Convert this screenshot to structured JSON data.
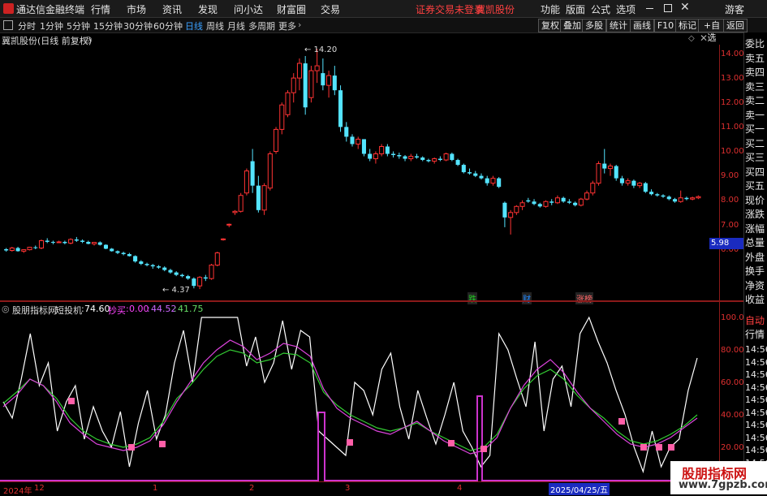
{
  "menubar": {
    "app_name": "通达信金融终端",
    "menus": [
      "行情",
      "市场",
      "资讯",
      "发现",
      "问小达",
      "财富圈",
      "交易"
    ],
    "notice": "证券交易未登录",
    "stock_name": "冀凯股份",
    "right_menus": [
      "功能",
      "版面",
      "公式",
      "选项"
    ],
    "guest": "游客",
    "window_controls": [
      "minimize-icon",
      "maximize-icon",
      "close-icon"
    ]
  },
  "periods": [
    "分时",
    "1分钟",
    "5分钟",
    "15分钟",
    "30分钟",
    "60分钟",
    "日线",
    "周线",
    "月线",
    "多周期",
    "更多"
  ],
  "active_period": "日线",
  "toolbar_buttons": [
    "复权",
    "叠加",
    "多股",
    "统计",
    "画线",
    "F10",
    "标记",
    "+自选",
    "返回"
  ],
  "main_chart": {
    "title": "冀凯股份(日线 前复权)",
    "high_label": "14.20",
    "low_label": "4.37",
    "current_price": "5.98",
    "y_ticks": [
      "14.00",
      "13.00",
      "12.00",
      "11.00",
      "10.00",
      "9.00",
      "8.00",
      "7.00",
      "6.00"
    ],
    "events": [
      {
        "label": "跌",
        "color": "#22cc22"
      },
      {
        "label": "财",
        "color": "#2288ff"
      },
      {
        "label": "涨榜",
        "color": "#ff6666"
      }
    ]
  },
  "indicator": {
    "title": "股朋指标网",
    "name": "短投机",
    "value": "74.60",
    "buy_label": "抄买",
    "buy_value": "0.00",
    "v2": "44.52",
    "v3": "41.75",
    "y_ticks": [
      "100.0",
      "80.00",
      "60.00",
      "40.00",
      "20.00"
    ]
  },
  "side_panel": {
    "labels": [
      "委比",
      "卖五",
      "卖四",
      "卖三",
      "卖二",
      "卖一",
      "买一",
      "买二",
      "买三",
      "买四",
      "买五",
      "现价",
      "涨跌",
      "涨幅",
      "总量",
      "外盘",
      "换手",
      "净资",
      "收益"
    ],
    "tabs": [
      "自动",
      "行情"
    ],
    "times": [
      "14:56",
      "14:56",
      "14:56",
      "14:56",
      "14:56",
      "14:56",
      "14:56",
      "14:56",
      "14:56",
      "14:56"
    ]
  },
  "time_axis": {
    "labels": [
      "2024年",
      "12",
      "1",
      "2",
      "3",
      "4",
      "2025/04/25/五"
    ]
  },
  "watermark": {
    "title": "股朋指标网",
    "url": "www.7gpzb.com"
  },
  "chart_data": {
    "type": "candlestick",
    "title": "冀凯股份(日线 前复权)",
    "ylim": [
      5.5,
      14.6
    ],
    "ohlc": [
      [
        6.0,
        6.05,
        5.9,
        5.95
      ],
      [
        5.95,
        6.1,
        5.9,
        6.05
      ],
      [
        6.05,
        6.1,
        5.9,
        5.92
      ],
      [
        5.92,
        6.0,
        5.85,
        5.98
      ],
      [
        5.98,
        6.1,
        5.95,
        6.08
      ],
      [
        6.08,
        6.15,
        6.0,
        6.05
      ],
      [
        6.05,
        6.4,
        6.0,
        6.35
      ],
      [
        6.35,
        6.45,
        6.25,
        6.3
      ],
      [
        6.3,
        6.35,
        6.2,
        6.28
      ],
      [
        6.28,
        6.35,
        6.25,
        6.3
      ],
      [
        6.3,
        6.35,
        6.2,
        6.25
      ],
      [
        6.25,
        6.45,
        6.2,
        6.4
      ],
      [
        6.4,
        6.5,
        6.3,
        6.35
      ],
      [
        6.35,
        6.4,
        6.25,
        6.3
      ],
      [
        6.3,
        6.35,
        6.2,
        6.22
      ],
      [
        6.22,
        6.3,
        6.15,
        6.28
      ],
      [
        6.28,
        6.32,
        6.15,
        6.18
      ],
      [
        6.18,
        6.2,
        6.0,
        6.02
      ],
      [
        6.02,
        6.05,
        5.9,
        5.92
      ],
      [
        5.92,
        5.95,
        5.8,
        5.85
      ],
      [
        5.85,
        5.9,
        5.75,
        5.8
      ],
      [
        5.8,
        5.85,
        5.7,
        5.72
      ],
      [
        5.72,
        5.75,
        5.45,
        5.5
      ],
      [
        5.5,
        5.55,
        5.35,
        5.4
      ],
      [
        5.4,
        5.45,
        5.3,
        5.35
      ],
      [
        5.35,
        5.4,
        5.2,
        5.3
      ],
      [
        5.3,
        5.35,
        5.2,
        5.25
      ],
      [
        5.25,
        5.3,
        5.1,
        5.15
      ],
      [
        5.15,
        5.2,
        5.0,
        5.05
      ],
      [
        5.05,
        5.1,
        4.9,
        4.95
      ],
      [
        4.95,
        5.0,
        4.85,
        4.9
      ],
      [
        4.9,
        4.95,
        4.75,
        4.8
      ],
      [
        4.8,
        4.85,
        4.4,
        4.5
      ],
      [
        4.5,
        4.9,
        4.37,
        4.85
      ],
      [
        4.85,
        4.95,
        4.7,
        4.8
      ],
      [
        4.8,
        5.4,
        4.75,
        5.35
      ],
      [
        5.35,
        5.9,
        5.3,
        5.85
      ],
      [
        6.4,
        6.45,
        6.35,
        6.42
      ],
      [
        7.0,
        7.05,
        6.9,
        7.02
      ],
      [
        7.5,
        7.6,
        7.4,
        7.55
      ],
      [
        7.55,
        8.3,
        7.5,
        8.2
      ],
      [
        8.3,
        9.3,
        8.2,
        9.2
      ],
      [
        9.6,
        10.1,
        8.3,
        8.6
      ],
      [
        8.6,
        9.0,
        7.5,
        7.6
      ],
      [
        7.6,
        8.7,
        7.4,
        8.6
      ],
      [
        8.5,
        10.0,
        8.4,
        9.9
      ],
      [
        10.0,
        11.0,
        9.9,
        10.9
      ],
      [
        10.9,
        12.0,
        10.7,
        11.9
      ],
      [
        11.5,
        12.5,
        11.4,
        12.4
      ],
      [
        12.4,
        13.2,
        12.0,
        13.0
      ],
      [
        13.0,
        13.8,
        12.5,
        13.6
      ],
      [
        13.6,
        13.9,
        11.5,
        11.8
      ],
      [
        12.2,
        13.5,
        12.0,
        13.3
      ],
      [
        13.3,
        14.2,
        12.8,
        13.5
      ],
      [
        13.2,
        13.8,
        12.5,
        12.7
      ],
      [
        12.7,
        13.3,
        12.2,
        13.1
      ],
      [
        13.1,
        13.5,
        12.3,
        12.5
      ],
      [
        12.5,
        12.7,
        10.8,
        11.0
      ],
      [
        11.0,
        11.2,
        10.4,
        10.6
      ],
      [
        10.6,
        10.7,
        10.2,
        10.3
      ],
      [
        10.3,
        10.6,
        10.1,
        10.5
      ],
      [
        10.5,
        10.5,
        9.8,
        9.9
      ],
      [
        9.9,
        10.1,
        9.6,
        9.7
      ],
      [
        9.7,
        10.0,
        9.5,
        9.9
      ],
      [
        9.9,
        10.3,
        9.8,
        10.2
      ],
      [
        10.2,
        10.3,
        9.8,
        9.9
      ],
      [
        9.9,
        10.0,
        9.75,
        9.85
      ],
      [
        9.85,
        9.95,
        9.7,
        9.8
      ],
      [
        9.8,
        9.85,
        9.6,
        9.7
      ],
      [
        9.7,
        9.9,
        9.6,
        9.8
      ],
      [
        9.8,
        9.9,
        9.7,
        9.75
      ],
      [
        9.75,
        9.8,
        9.6,
        9.65
      ],
      [
        9.65,
        9.7,
        9.55,
        9.6
      ],
      [
        9.6,
        9.75,
        9.5,
        9.7
      ],
      [
        9.7,
        9.8,
        9.6,
        9.65
      ],
      [
        9.65,
        9.95,
        9.6,
        9.9
      ],
      [
        9.9,
        9.95,
        9.6,
        9.65
      ],
      [
        9.65,
        9.7,
        9.4,
        9.45
      ],
      [
        9.45,
        9.5,
        9.1,
        9.15
      ],
      [
        9.15,
        9.3,
        9.05,
        9.1
      ],
      [
        9.1,
        9.2,
        8.95,
        9.0
      ],
      [
        9.0,
        9.1,
        8.85,
        8.9
      ],
      [
        8.9,
        9.0,
        8.6,
        8.7
      ],
      [
        8.7,
        9.0,
        8.6,
        8.9
      ],
      [
        8.9,
        8.95,
        8.5,
        8.55
      ],
      [
        7.9,
        7.95,
        6.9,
        7.3
      ],
      [
        7.3,
        7.6,
        6.6,
        7.5
      ],
      [
        7.5,
        7.8,
        7.4,
        7.75
      ],
      [
        7.75,
        8.0,
        7.6,
        7.9
      ],
      [
        8.0,
        8.1,
        7.9,
        7.95
      ],
      [
        7.95,
        8.05,
        7.8,
        7.85
      ],
      [
        7.85,
        7.9,
        7.7,
        7.75
      ],
      [
        7.75,
        8.0,
        7.7,
        7.95
      ],
      [
        7.95,
        8.05,
        7.8,
        7.9
      ],
      [
        7.9,
        8.2,
        7.85,
        8.1
      ],
      [
        8.1,
        8.15,
        7.9,
        7.95
      ],
      [
        7.95,
        8.05,
        7.85,
        7.9
      ],
      [
        7.9,
        7.95,
        7.75,
        7.8
      ],
      [
        7.8,
        8.1,
        7.75,
        8.05
      ],
      [
        8.05,
        8.4,
        8.0,
        8.3
      ],
      [
        8.3,
        8.8,
        8.2,
        8.7
      ],
      [
        8.7,
        9.6,
        8.6,
        9.5
      ],
      [
        9.5,
        10.1,
        9.1,
        9.3
      ],
      [
        9.3,
        9.5,
        9.0,
        9.4
      ],
      [
        9.4,
        9.45,
        8.8,
        8.9
      ],
      [
        8.9,
        9.0,
        8.6,
        8.7
      ],
      [
        8.7,
        8.9,
        8.6,
        8.8
      ],
      [
        8.8,
        8.85,
        8.5,
        8.6
      ],
      [
        8.6,
        8.75,
        8.5,
        8.7
      ],
      [
        8.7,
        8.75,
        8.3,
        8.35
      ],
      [
        8.35,
        8.45,
        8.2,
        8.25
      ],
      [
        8.25,
        8.3,
        8.15,
        8.2
      ],
      [
        8.2,
        8.25,
        8.1,
        8.15
      ],
      [
        8.15,
        8.2,
        8.0,
        8.05
      ],
      [
        8.05,
        8.1,
        7.9,
        7.95
      ],
      [
        7.95,
        8.4,
        7.9,
        8.1
      ],
      [
        8.1,
        8.15,
        8.0,
        8.05
      ],
      [
        8.05,
        8.15,
        8.0,
        8.1
      ],
      [
        8.1,
        8.2,
        8.05,
        8.15
      ]
    ],
    "indicator_white": [
      48,
      38,
      62,
      90,
      58,
      72,
      30,
      48,
      58,
      25,
      45,
      30,
      20,
      42,
      8,
      35,
      55,
      25,
      40,
      72,
      92,
      60,
      100,
      100,
      100,
      100,
      100,
      70,
      88,
      60,
      72,
      98,
      68,
      92,
      88,
      30,
      25,
      20,
      15,
      60,
      55,
      40,
      68,
      78,
      45,
      25,
      55,
      38,
      22,
      40,
      60,
      30,
      20,
      8,
      15,
      90,
      80,
      62,
      45,
      85,
      30,
      62,
      70,
      45,
      90,
      100,
      85,
      72,
      55,
      40,
      20,
      5,
      30,
      8,
      20,
      25,
      55,
      75
    ],
    "indicator_purple": [
      45,
      52,
      62,
      58,
      48,
      35,
      28,
      22,
      20,
      18,
      20,
      24,
      34,
      48,
      60,
      72,
      80,
      86,
      82,
      74,
      78,
      84,
      82,
      76,
      56,
      44,
      38,
      34,
      30,
      28,
      32,
      36,
      30,
      24,
      20,
      16,
      18,
      26,
      44,
      58,
      68,
      74,
      66,
      54,
      44,
      36,
      28,
      22,
      20,
      22,
      26,
      32,
      38
    ],
    "indicator_green": [
      47,
      54,
      62,
      58,
      50,
      38,
      30,
      25,
      22,
      20,
      22,
      26,
      36,
      50,
      58,
      68,
      76,
      80,
      78,
      72,
      74,
      78,
      77,
      72,
      54,
      46,
      40,
      36,
      32,
      30,
      32,
      35,
      30,
      26,
      22,
      18,
      20,
      28,
      44,
      56,
      64,
      68,
      62,
      52,
      44,
      38,
      30,
      24,
      22,
      24,
      28,
      33,
      40
    ],
    "buy_signals": [
      10,
      20,
      24,
      53,
      71,
      75,
      93,
      100,
      103,
      105
    ]
  }
}
